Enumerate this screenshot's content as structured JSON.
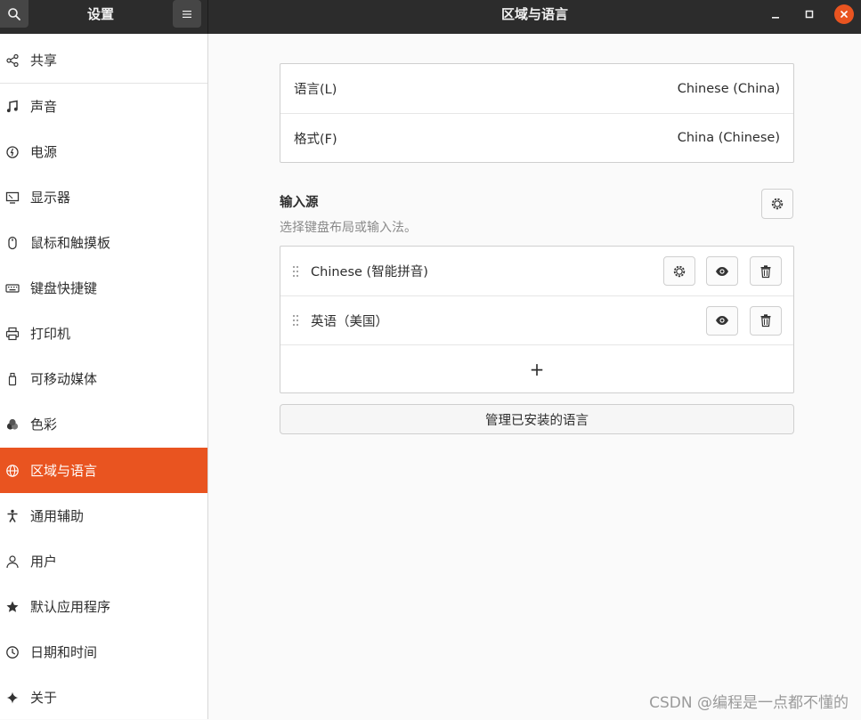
{
  "header": {
    "sidebar_title": "设置",
    "title": "区域与语言",
    "search_icon": "search-icon",
    "menu_icon": "hamburger-icon"
  },
  "sidebar": {
    "items": [
      {
        "label": "共享",
        "icon": "share-icon"
      },
      {
        "label": "声音",
        "icon": "music-note-icon"
      },
      {
        "label": "电源",
        "icon": "power-icon"
      },
      {
        "label": "显示器",
        "icon": "display-icon"
      },
      {
        "label": "鼠标和触摸板",
        "icon": "mouse-icon"
      },
      {
        "label": "键盘快捷键",
        "icon": "keyboard-icon"
      },
      {
        "label": "打印机",
        "icon": "printer-icon"
      },
      {
        "label": "可移动媒体",
        "icon": "removable-media-icon"
      },
      {
        "label": "色彩",
        "icon": "color-icon"
      },
      {
        "label": "区域与语言",
        "icon": "globe-icon",
        "active": true
      },
      {
        "label": "通用辅助",
        "icon": "accessibility-icon"
      },
      {
        "label": "用户",
        "icon": "user-icon"
      },
      {
        "label": "默认应用程序",
        "icon": "star-icon"
      },
      {
        "label": "日期和时间",
        "icon": "clock-icon"
      },
      {
        "label": "关于",
        "icon": "sparkle-icon"
      }
    ]
  },
  "language": {
    "label": "语言(L)",
    "value": "Chinese (China)"
  },
  "formats": {
    "label": "格式(F)",
    "value": "China (Chinese)"
  },
  "input_sources": {
    "title": "输入源",
    "subtitle": "选择键盘布局或输入法。",
    "items": [
      {
        "label": "Chinese (智能拼音)",
        "has_settings": true
      },
      {
        "label": "英语（美国）",
        "has_settings": false
      }
    ],
    "add_label": "+"
  },
  "manage_button": "管理已安装的语言",
  "watermark": "CSDN @编程是一点都不懂的",
  "colors": {
    "accent": "#e95420",
    "headerbar": "#2c2c2c"
  }
}
